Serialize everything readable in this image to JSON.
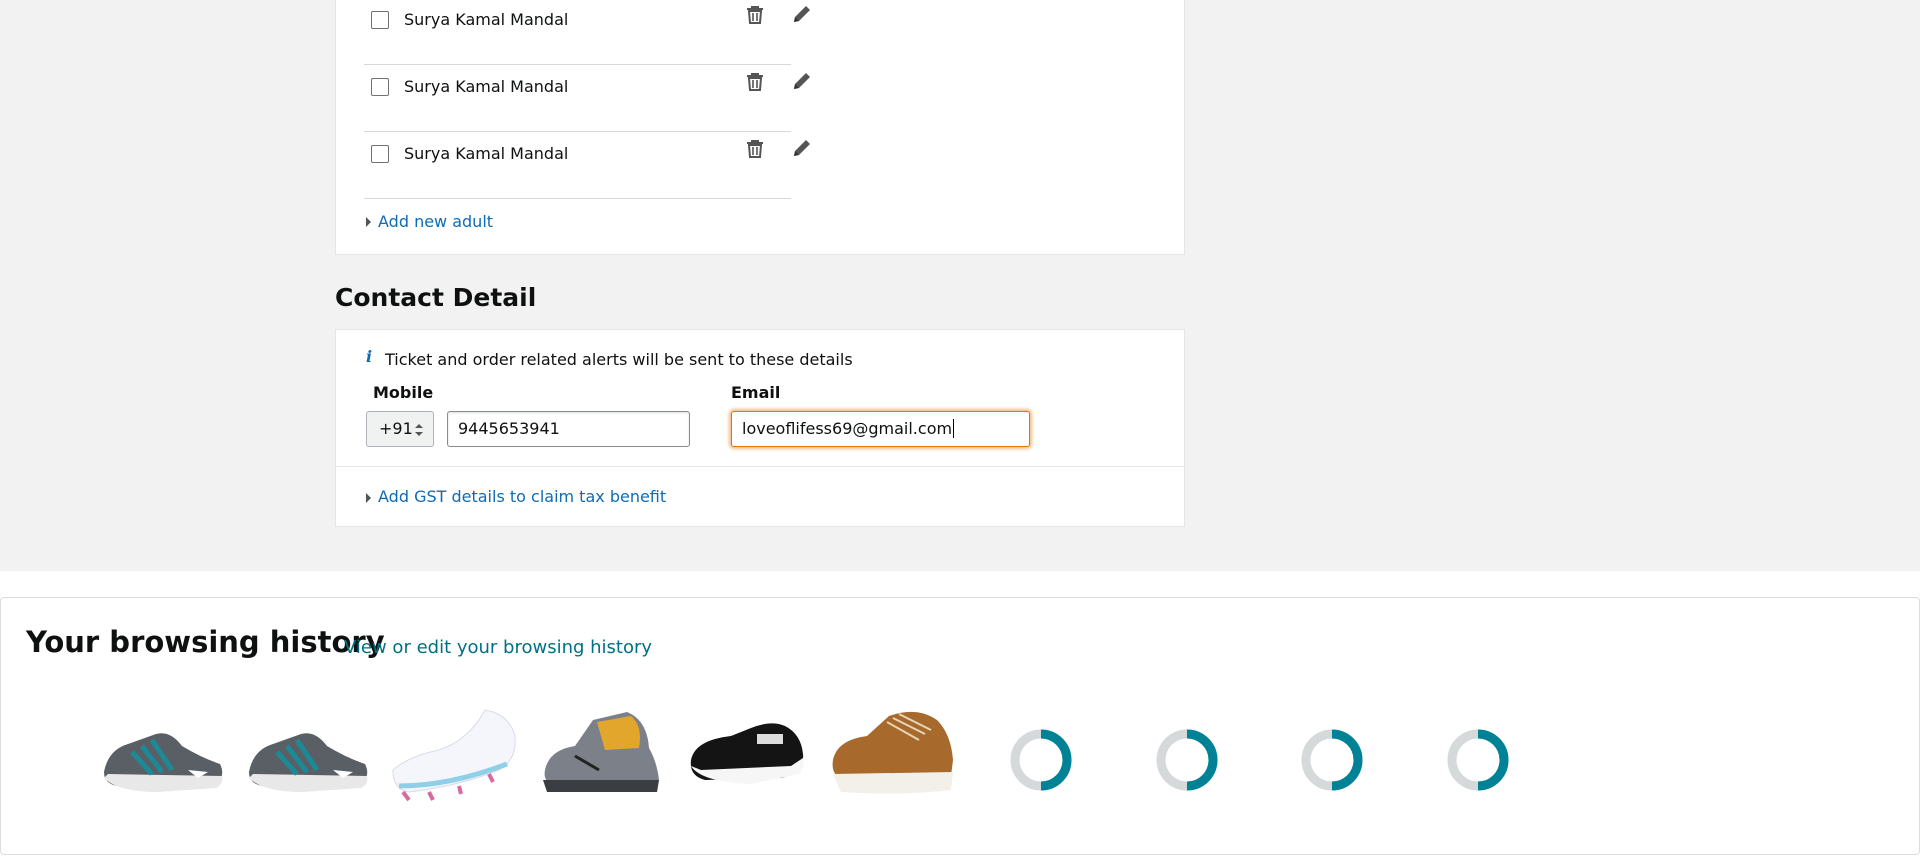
{
  "adults": {
    "rows": [
      {
        "name": "Surya Kamal Mandal"
      },
      {
        "name": "Surya Kamal Mandal"
      },
      {
        "name": "Surya Kamal Mandal"
      }
    ],
    "add_label": "Add new adult"
  },
  "contact": {
    "title": "Contact Detail",
    "info_icon": "i",
    "info_text": "Ticket and order related alerts will be sent to these details",
    "mobile_label": "Mobile",
    "country_code": "+91",
    "mobile_value": "9445653941",
    "email_label": "Email",
    "email_value": "loveoflifess69@gmail.com",
    "gst_label": "Add GST details to claim tax benefit"
  },
  "history": {
    "title": "Your browsing history",
    "link": "View or edit your browsing history",
    "items": [
      {
        "icon": "grey-teal-running-shoe"
      },
      {
        "icon": "grey-teal-running-shoe"
      },
      {
        "icon": "white-football-boot"
      },
      {
        "icon": "grey-yellow-hiking-boot"
      },
      {
        "icon": "black-white-kids-shoe"
      },
      {
        "icon": "brown-sneaker"
      },
      {
        "icon": "loading-spinner"
      },
      {
        "icon": "loading-spinner"
      },
      {
        "icon": "loading-spinner"
      },
      {
        "icon": "loading-spinner"
      }
    ]
  },
  "colors": {
    "link": "#007185",
    "focus_border": "#e77600",
    "spinner_fg": "#008296",
    "spinner_bg": "#d5d9d9"
  }
}
